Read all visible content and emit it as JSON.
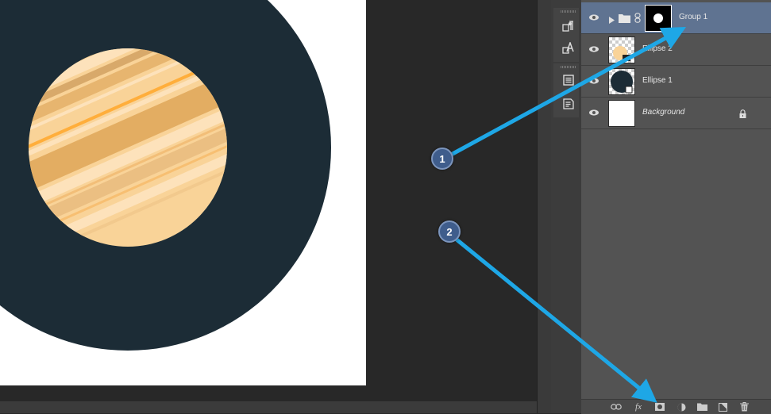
{
  "layers": [
    {
      "name": "Group 1",
      "selected": true,
      "italic": false
    },
    {
      "name": "Ellipse 2",
      "selected": false,
      "italic": false
    },
    {
      "name": "Ellipse 1",
      "selected": false,
      "italic": false
    },
    {
      "name": "Background",
      "selected": false,
      "italic": true
    }
  ],
  "callouts": {
    "one": "1",
    "two": "2"
  },
  "footer": {
    "fx_label": "fx"
  },
  "icons": {
    "eye": "eye-icon",
    "folder": "folder-icon",
    "link": "chain-link-icon",
    "lock": "lock-icon",
    "expand": "triangle-right-icon",
    "paragraph": "paragraph-icon",
    "character": "character-icon",
    "notes": "notes-icon",
    "properties": "properties-icon",
    "mask": "mask-icon",
    "adjustment": "adjustment-icon",
    "new_group": "folder-icon",
    "new_layer": "new-layer-icon",
    "delete": "trash-icon"
  },
  "colors": {
    "planet_ring": "#1c2c36",
    "planet_body": "#f9d398",
    "stripe_orange": "#ffae3b",
    "selected_row": "#5f7391",
    "callout_blue": "#1ea7e6",
    "callout_badge": "#3f5d8c"
  }
}
